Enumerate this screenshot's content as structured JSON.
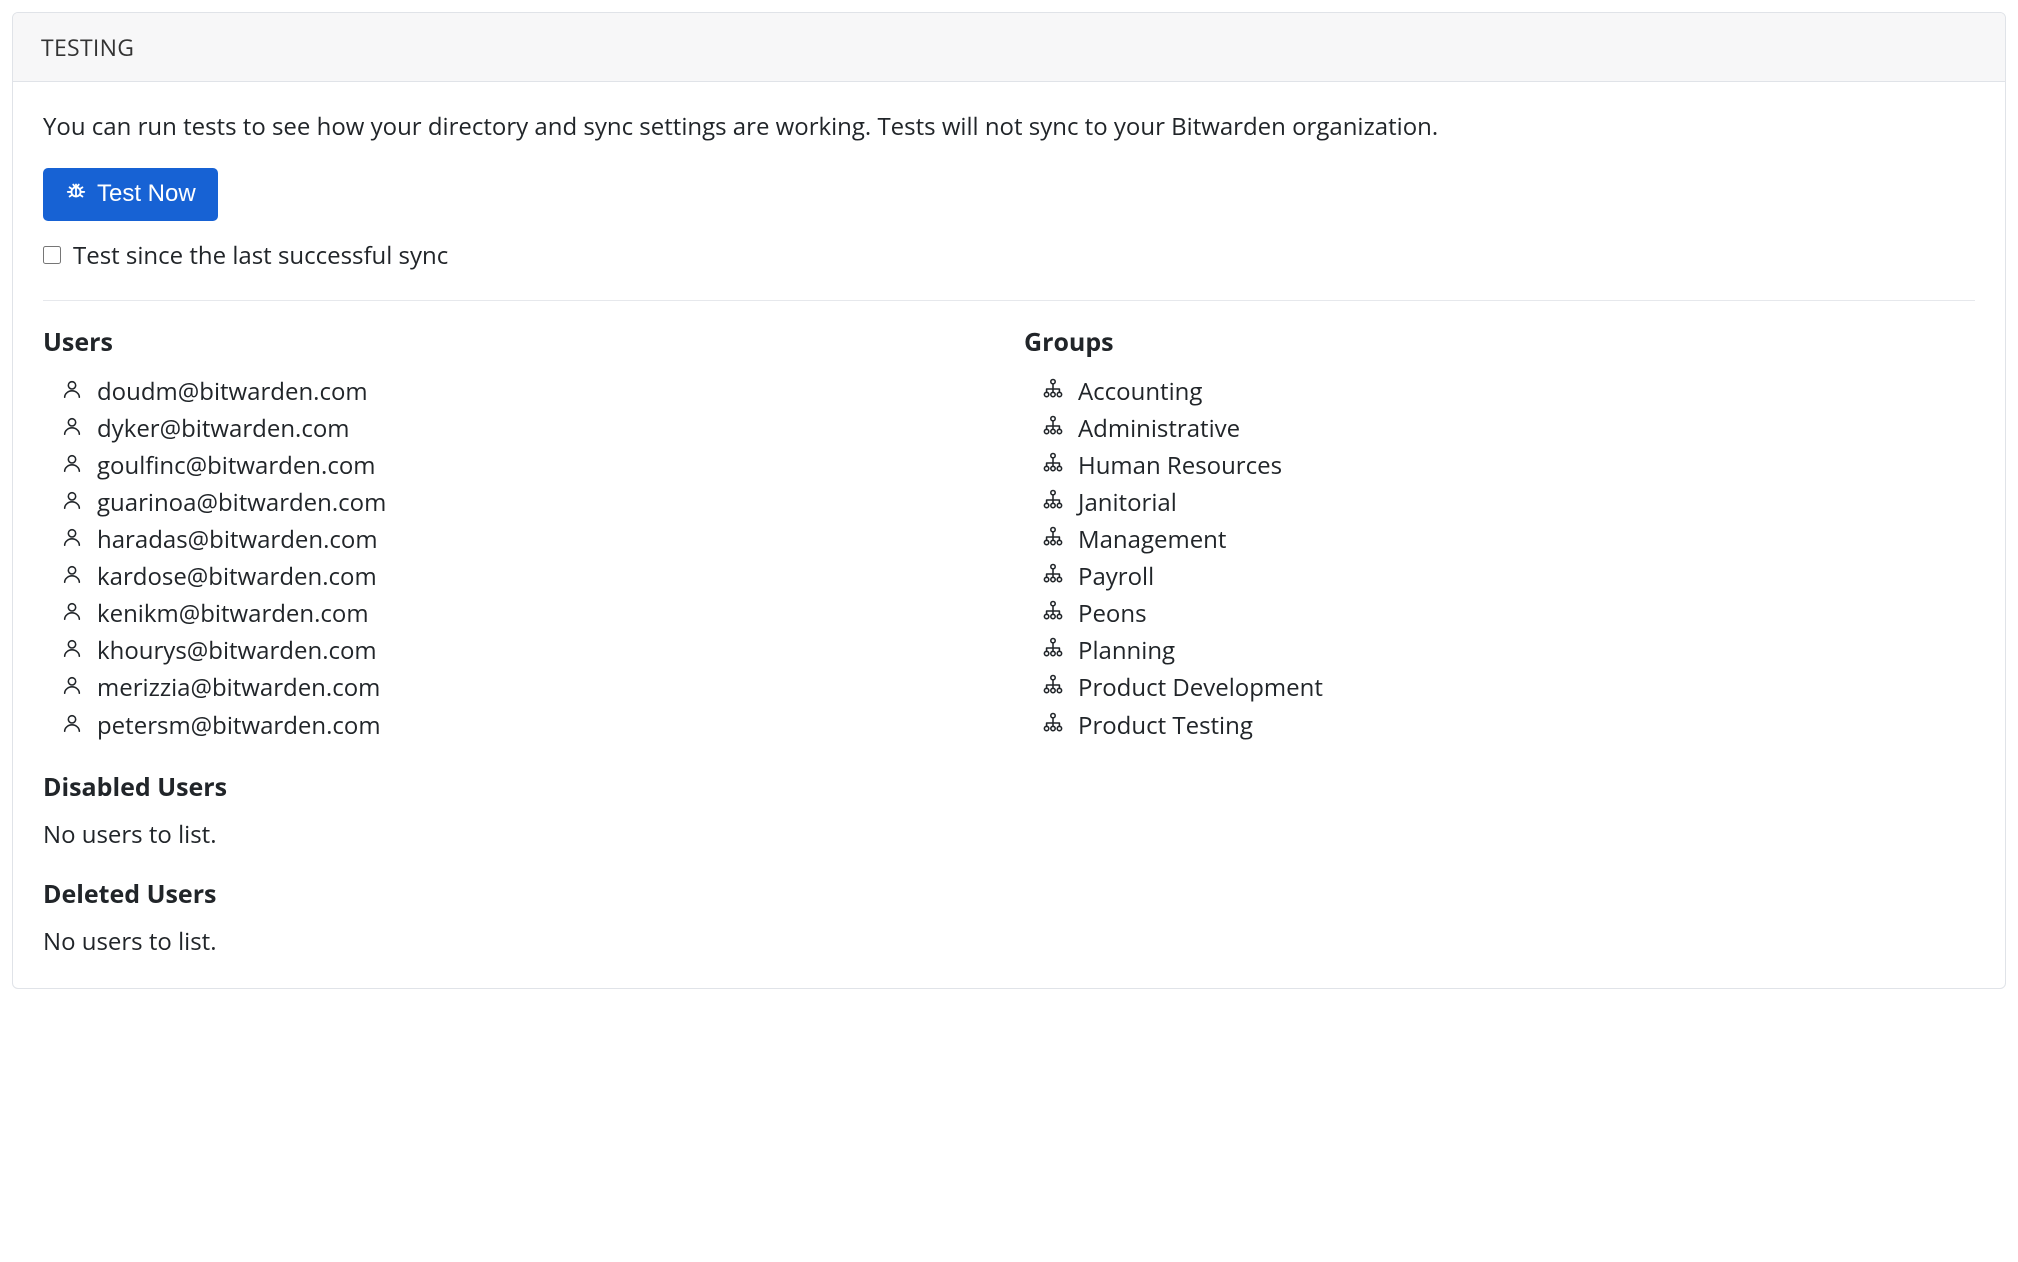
{
  "header": {
    "title": "Testing"
  },
  "intro": "You can run tests to see how your directory and sync settings are working. Tests will not sync to your Bitwarden organization.",
  "actions": {
    "test_now_label": "Test Now",
    "test_since_last_sync_label": "Test since the last successful sync",
    "test_since_last_sync_checked": false
  },
  "users_section": {
    "title": "Users",
    "items": [
      "doudm@bitwarden.com",
      "dyker@bitwarden.com",
      "goulfinc@bitwarden.com",
      "guarinoa@bitwarden.com",
      "haradas@bitwarden.com",
      "kardose@bitwarden.com",
      "kenikm@bitwarden.com",
      "khourys@bitwarden.com",
      "merizzia@bitwarden.com",
      "petersm@bitwarden.com"
    ]
  },
  "disabled_users_section": {
    "title": "Disabled Users",
    "empty": "No users to list."
  },
  "deleted_users_section": {
    "title": "Deleted Users",
    "empty": "No users to list."
  },
  "groups_section": {
    "title": "Groups",
    "items": [
      "Accounting",
      "Administrative",
      "Human Resources",
      "Janitorial",
      "Management",
      "Payroll",
      "Peons",
      "Planning",
      "Product Development",
      "Product Testing"
    ]
  },
  "colors": {
    "primary": "#1762d4"
  }
}
